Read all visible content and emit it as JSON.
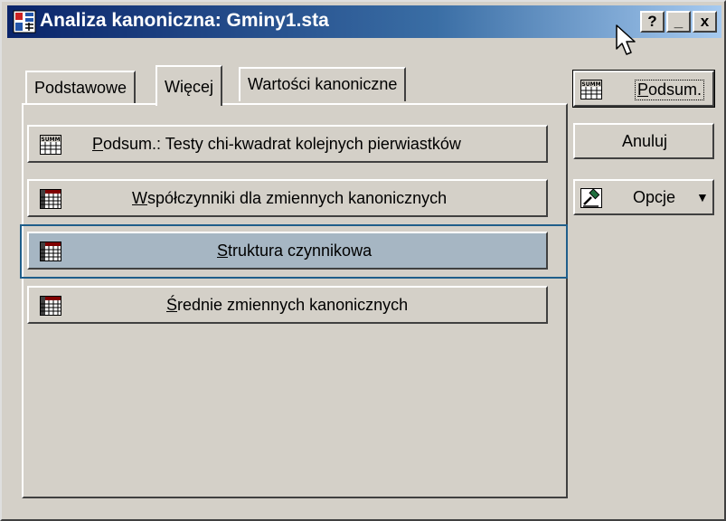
{
  "window": {
    "title": "Analiza kanoniczna: Gminy1.sta",
    "buttons": {
      "help": "?",
      "minimize": "_",
      "close": "x"
    }
  },
  "tabs": [
    {
      "label": "Podstawowe",
      "active": false
    },
    {
      "label": "Więcej",
      "active": true
    },
    {
      "label": "Wartości kanoniczne",
      "active": false
    }
  ],
  "actions": [
    {
      "pre": "",
      "key": "P",
      "post": "odsum.: Testy chi-kwadrat kolejnych pierwiastków",
      "icon": "summary-icon"
    },
    {
      "pre": "",
      "key": "W",
      "post": "spółczynniki dla zmiennych kanonicznych",
      "icon": "spreadsheet-icon"
    },
    {
      "pre": "",
      "key": "S",
      "post": "truktura czynnikowa",
      "icon": "spreadsheet-icon",
      "selected": true
    },
    {
      "pre": "",
      "key": "Ś",
      "post": "rednie zmiennych kanonicznych",
      "icon": "spreadsheet-icon"
    }
  ],
  "side_buttons": {
    "summary": {
      "pre": "",
      "key": "P",
      "post": "odsum.",
      "icon": "summary-icon"
    },
    "cancel": {
      "label": "Anuluj"
    },
    "options": {
      "label": "Opcje",
      "arrow": "▼",
      "icon": "gavel-icon"
    }
  },
  "colors": {
    "titlebar_start": "#0a246a",
    "titlebar_end": "#a6caf0",
    "face": "#d4d0c8",
    "selected_button": "#a6b6c3",
    "focus_ring": "#1f5e8a"
  }
}
